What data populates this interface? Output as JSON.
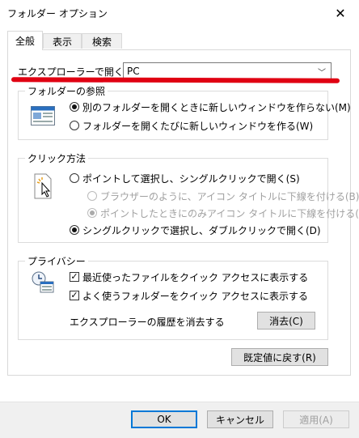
{
  "window": {
    "title": "フォルダー オプション"
  },
  "tabs": [
    {
      "label": "全般"
    },
    {
      "label": "表示"
    },
    {
      "label": "検索"
    }
  ],
  "open_in": {
    "label": "エクスプローラーで開く:",
    "value": "PC"
  },
  "browse": {
    "legend": "フォルダーの参照",
    "options": [
      {
        "label": "別のフォルダーを開くときに新しいウィンドウを作らない(M)",
        "selected": true
      },
      {
        "label": "フォルダーを開くたびに新しいウィンドウを作る(W)",
        "selected": false
      }
    ]
  },
  "click": {
    "legend": "クリック方法",
    "single": "ポイントして選択し、シングルクリックで開く(S)",
    "sub1": "ブラウザーのように、アイコン タイトルに下線を付ける(B)",
    "sub2": "ポイントしたときにのみアイコン タイトルに下線を付ける(P)",
    "double": "シングルクリックで選択し、ダブルクリックで開く(D)"
  },
  "privacy": {
    "legend": "プライバシー",
    "recent": "最近使ったファイルをクイック アクセスに表示する",
    "frequent": "よく使うフォルダーをクイック アクセスに表示する",
    "clear_label": "エクスプローラーの履歴を消去する",
    "clear_button": "消去(C)"
  },
  "restore_button": "既定値に戻す(R)",
  "footer": {
    "ok": "OK",
    "cancel": "キャンセル",
    "apply": "適用(A)"
  },
  "colors": {
    "accent": "#0078d7",
    "annotation_line": "#e00012"
  }
}
